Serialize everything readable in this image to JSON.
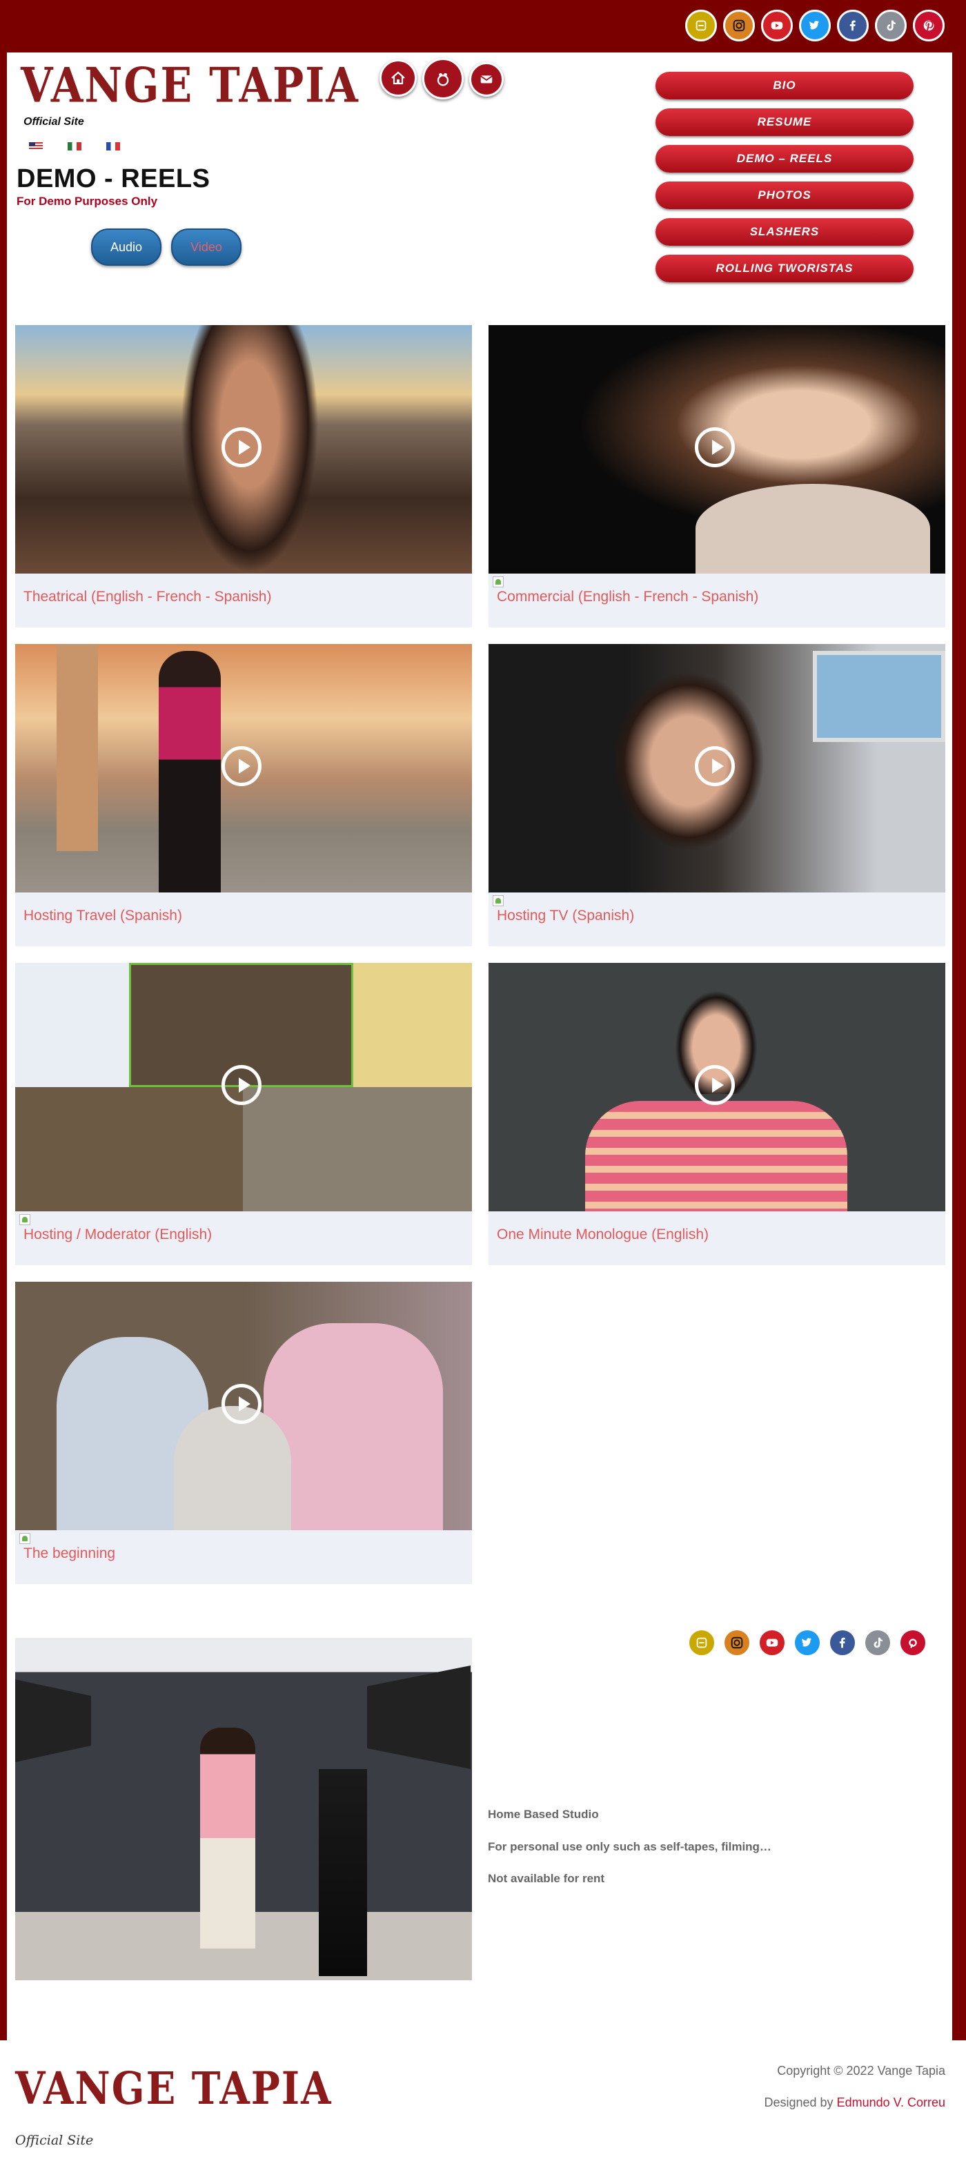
{
  "header": {
    "logo": "VANGE TAPIA",
    "official": "Official Site"
  },
  "social": [
    "rumble-icon",
    "instagram-icon",
    "youtube-icon",
    "twitter-icon",
    "facebook-icon",
    "tiktok-icon",
    "pinterest-icon"
  ],
  "page": {
    "title": "DEMO - REELS",
    "subtitle": "For Demo Purposes Only"
  },
  "toggle": {
    "audio": "Audio",
    "video": "Video"
  },
  "menu": [
    "BIO",
    "RESUME",
    "DEMO – REELS",
    "PHOTOS",
    "SLASHERS",
    "ROLLING TWORISTAS"
  ],
  "videos": [
    "Theatrical (English - French - Spanish)",
    "Commercial (English - French - Spanish)",
    "Hosting Travel (Spanish)",
    "Hosting TV (Spanish)",
    "Hosting / Moderator (English)",
    "One Minute Monologue (English)",
    "The beginning"
  ],
  "studio": {
    "line1": "Home Based Studio",
    "line2": "For personal use only such as self-tapes, filming…",
    "line3": "Not available for rent"
  },
  "footer": {
    "logo": "VANGE TAPIA",
    "official": "Official Site",
    "copyright": "Copyright © 2022 Vange Tapia",
    "designed_prefix": "Designed by ",
    "designer": "Edmundo V. Correu"
  },
  "colors": {
    "brand": "#7a0000",
    "accent": "#e05a5a",
    "button": "#c8102e"
  }
}
